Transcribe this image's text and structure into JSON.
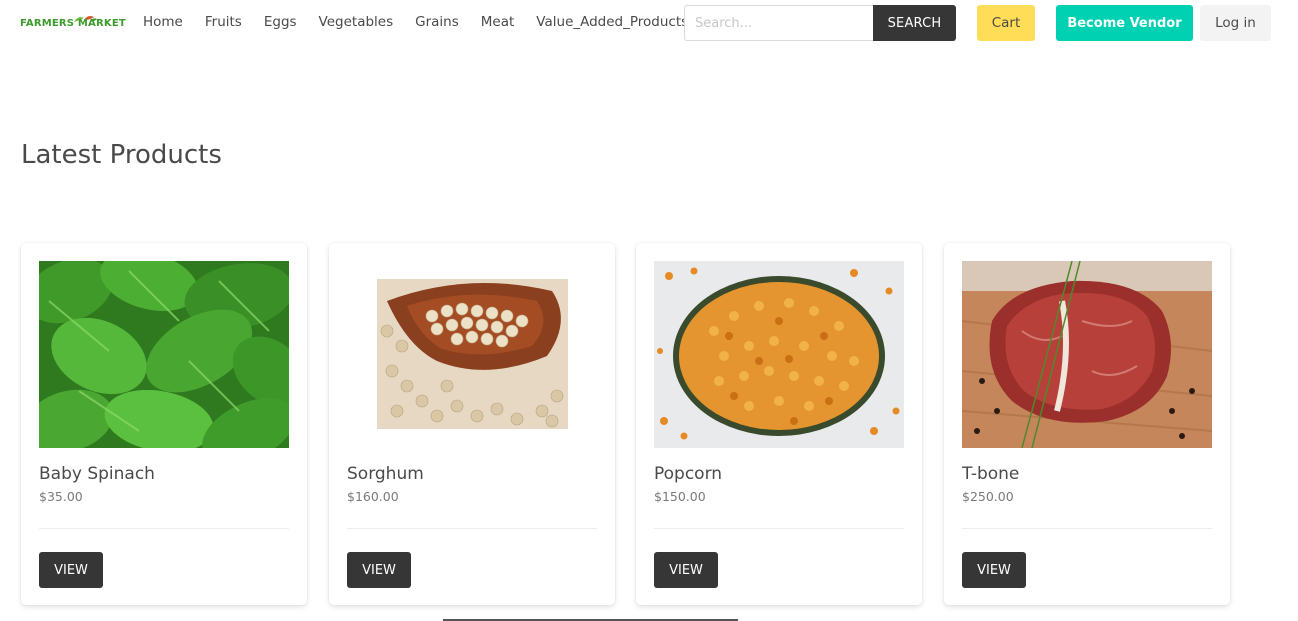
{
  "brand": {
    "logo_text": "FARMERS MARKET"
  },
  "nav": {
    "links": [
      "Home",
      "Fruits",
      "Eggs",
      "Vegetables",
      "Grains",
      "Meat",
      "Value_Added_Products"
    ]
  },
  "search": {
    "placeholder": "Search...",
    "button_label": "SEARCH"
  },
  "actions": {
    "cart_label": "Cart",
    "vendor_label": "Become Vendor",
    "login_label": "Log in"
  },
  "colors": {
    "cart": "#ffdd57",
    "vendor": "#00d1b2",
    "dark_button": "#363636",
    "logo_green": "#3d9b2c"
  },
  "main": {
    "title": "Latest Products",
    "products": [
      {
        "name": "Baby Spinach",
        "price": "$35.00",
        "button": "VIEW",
        "image": "spinach-leaves"
      },
      {
        "name": "Sorghum",
        "price": "$160.00",
        "button": "VIEW",
        "image": "sorghum-grains-spoon"
      },
      {
        "name": "Popcorn",
        "price": "$150.00",
        "button": "VIEW",
        "image": "popcorn-kernels-bowl"
      },
      {
        "name": "T-bone",
        "price": "$250.00",
        "button": "VIEW",
        "image": "tbone-steak"
      }
    ]
  }
}
